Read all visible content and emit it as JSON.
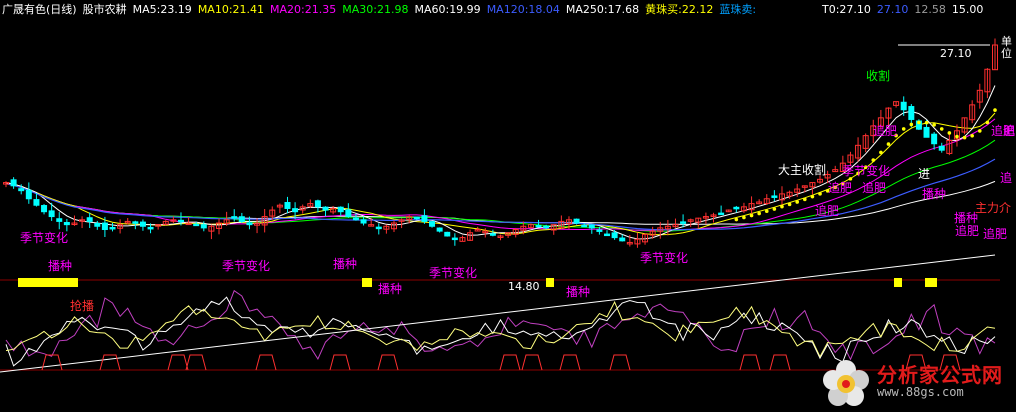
{
  "header": {
    "title": "广晟有色(日线)",
    "indicator_name": "股市农耕",
    "ma_items": [
      {
        "text": "MA5:23.19",
        "color": "#ffffff"
      },
      {
        "text": "MA10:21.41",
        "color": "#ffff00"
      },
      {
        "text": "MA20:21.35",
        "color": "#ff00ff"
      },
      {
        "text": "MA30:21.98",
        "color": "#00ff00"
      },
      {
        "text": "MA60:19.99",
        "color": "#ffffff"
      },
      {
        "text": "MA120:18.04",
        "color": "#3c5cff"
      },
      {
        "text": "MA250:17.68",
        "color": "#ffffff"
      },
      {
        "text": "黄珠买:22.12",
        "color": "#ffff00"
      },
      {
        "text": "蓝珠卖:",
        "color": "#00a0ff"
      }
    ],
    "right_items": [
      {
        "text": "T0:27.10",
        "color": "#ffffff"
      },
      {
        "text": "27.10",
        "color": "#3c5cff"
      },
      {
        "text": "12.58",
        "color": "#9a9a9a"
      },
      {
        "text": "15.00",
        "color": "#ffffff"
      }
    ]
  },
  "unit_label": "单位",
  "price_labels": {
    "high": "27.10",
    "low": "14.80"
  },
  "annotations": [
    {
      "text": "收割",
      "color": "#00ff00"
    },
    {
      "text": "追肥",
      "color": "#ff00ff"
    },
    {
      "text": "追肥",
      "color": "#ff00ff"
    },
    {
      "text": "追肥",
      "color": "#ff00ff"
    },
    {
      "text": "追肥",
      "color": "#ff00ff"
    },
    {
      "text": "追肥",
      "color": "#ff00ff"
    },
    {
      "text": "追肥",
      "color": "#ff00ff"
    },
    {
      "text": "追肥",
      "color": "#ff00ff"
    },
    {
      "text": "追",
      "color": "#ff00ff"
    },
    {
      "text": "追",
      "color": "#ff00ff"
    },
    {
      "text": "季节变化",
      "color": "#ff00ff"
    },
    {
      "text": "季节变化",
      "color": "#ff00ff"
    },
    {
      "text": "季节变化",
      "color": "#ff00ff"
    },
    {
      "text": "季节变化",
      "color": "#ff00ff"
    },
    {
      "text": "季节变化",
      "color": "#ff00ff"
    },
    {
      "text": "播种",
      "color": "#ff00ff"
    },
    {
      "text": "播种",
      "color": "#ff00ff"
    },
    {
      "text": "播种",
      "color": "#ff00ff"
    },
    {
      "text": "播种",
      "color": "#ff00ff"
    },
    {
      "text": "播种",
      "color": "#ff00ff"
    },
    {
      "text": "播种",
      "color": "#ff00ff"
    },
    {
      "text": "抢播",
      "color": "#ff3030"
    },
    {
      "text": "主力介",
      "color": "#ff3030"
    },
    {
      "text": "大主收割",
      "color": "#ffffff"
    },
    {
      "text": "进",
      "color": "#ffffff"
    }
  ],
  "watermark": {
    "title": "分析家公式网",
    "url": "www.88gs.com"
  },
  "colors": {
    "background": "#000000",
    "candle_up": "#ff3030",
    "candle_down": "#00ffff",
    "ma5": "#ffffff",
    "ma10": "#ffff00",
    "ma20": "#ff00ff",
    "ma30": "#00ff00",
    "ma60": "#ffffff",
    "ma120": "#3c5cff",
    "ma250": "#ffffff",
    "bar_buy": "#ffff00",
    "divider": "#8b0000"
  },
  "chart_data": {
    "type": "candlestick",
    "title": "广晟有色(日线)",
    "ylim": [
      12.58,
      27.1
    ],
    "y_markers": [
      27.1,
      14.8
    ],
    "closes": [
      18.6,
      18.4,
      18.1,
      17.6,
      17.2,
      16.8,
      16.5,
      16.2,
      16.0,
      16.1,
      16.3,
      16.2,
      15.9,
      15.7,
      15.8,
      16.0,
      16.2,
      16.1,
      15.9,
      15.8,
      16.0,
      16.2,
      16.3,
      16.2,
      16.1,
      16.0,
      15.8,
      15.9,
      16.1,
      16.3,
      16.4,
      16.2,
      16.0,
      16.1,
      16.5,
      16.9,
      17.2,
      17.0,
      16.8,
      17.1,
      17.3,
      17.1,
      16.9,
      17.0,
      16.8,
      16.5,
      16.3,
      16.1,
      16.0,
      15.8,
      15.9,
      16.1,
      16.3,
      16.5,
      16.4,
      16.2,
      15.9,
      15.6,
      15.3,
      15.1,
      15.2,
      15.5,
      15.7,
      15.6,
      15.4,
      15.3,
      15.5,
      15.7,
      15.9,
      16.0,
      15.9,
      15.8,
      16.0,
      16.2,
      16.3,
      16.1,
      15.9,
      15.8,
      15.6,
      15.4,
      15.2,
      15.0,
      14.9,
      15.1,
      15.4,
      15.6,
      15.8,
      15.9,
      16.0,
      16.1,
      16.3,
      16.4,
      16.5,
      16.6,
      16.7,
      16.9,
      17.0,
      17.1,
      17.3,
      17.4,
      17.6,
      17.7,
      17.9,
      18.0,
      18.2,
      18.4,
      18.6,
      18.8,
      19.1,
      19.4,
      19.8,
      20.3,
      20.9,
      21.5,
      22.1,
      22.6,
      23.2,
      23.6,
      23.1,
      22.5,
      21.9,
      21.4,
      21.0,
      20.6,
      21.2,
      21.8,
      22.6,
      23.4,
      24.3,
      25.6,
      27.1
    ],
    "series": [
      {
        "name": "MA5",
        "value": 23.19
      },
      {
        "name": "MA10",
        "value": 21.41
      },
      {
        "name": "MA20",
        "value": 21.35
      },
      {
        "name": "MA30",
        "value": 21.98
      },
      {
        "name": "MA60",
        "value": 19.99
      },
      {
        "name": "MA120",
        "value": 18.04
      },
      {
        "name": "MA250",
        "value": 17.68
      },
      {
        "name": "黄珠买",
        "value": 22.12
      }
    ]
  }
}
